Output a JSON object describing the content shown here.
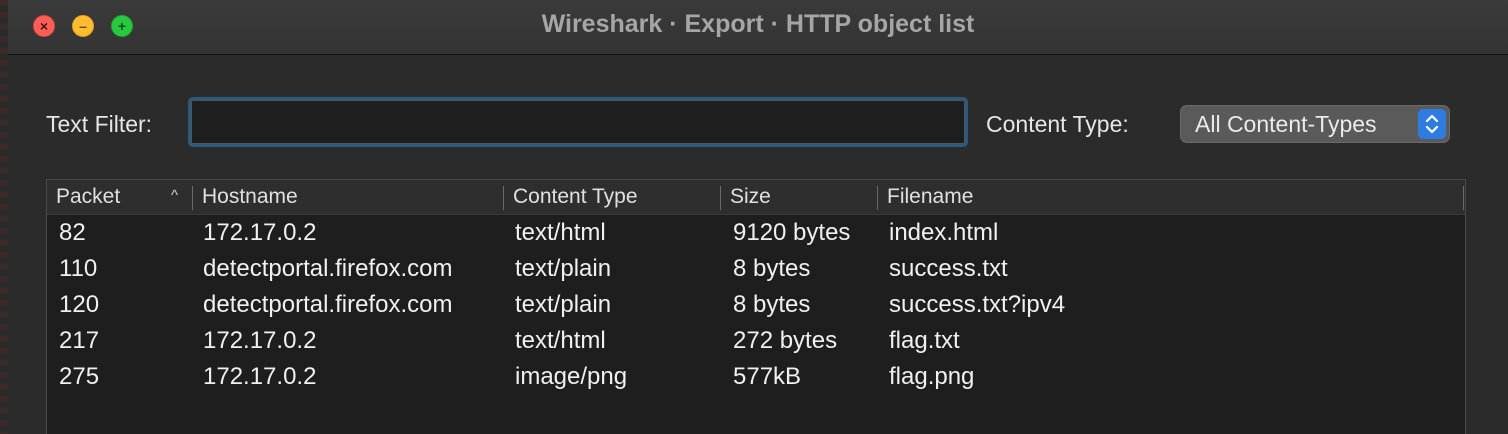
{
  "window": {
    "title": "Wireshark · Export · HTTP object list",
    "controls": {
      "close": "×",
      "minimize": "–",
      "zoom": "+"
    }
  },
  "filter": {
    "label": "Text Filter:",
    "value": "",
    "placeholder": ""
  },
  "content_type": {
    "label": "Content Type:",
    "selected": "All Content-Types"
  },
  "table": {
    "columns": [
      "Packet",
      "Hostname",
      "Content Type",
      "Size",
      "Filename"
    ],
    "sort_indicator": "^",
    "rows": [
      {
        "packet": "82",
        "hostname": "172.17.0.2",
        "content_type": "text/html",
        "size": "9120 bytes",
        "filename": "index.html"
      },
      {
        "packet": "110",
        "hostname": "detectportal.firefox.com",
        "content_type": "text/plain",
        "size": "8 bytes",
        "filename": "success.txt"
      },
      {
        "packet": "120",
        "hostname": "detectportal.firefox.com",
        "content_type": "text/plain",
        "size": "8 bytes",
        "filename": "success.txt?ipv4"
      },
      {
        "packet": "217",
        "hostname": "172.17.0.2",
        "content_type": "text/html",
        "size": "272 bytes",
        "filename": "flag.txt"
      },
      {
        "packet": "275",
        "hostname": "172.17.0.2",
        "content_type": "image/png",
        "size": "577kB",
        "filename": "flag.png"
      }
    ]
  },
  "colors": {
    "accent": "#2f7ce0",
    "focus_ring": "#2c5a7e",
    "close": "#ff5f57",
    "minimize": "#febc2e",
    "zoom": "#28c840"
  }
}
